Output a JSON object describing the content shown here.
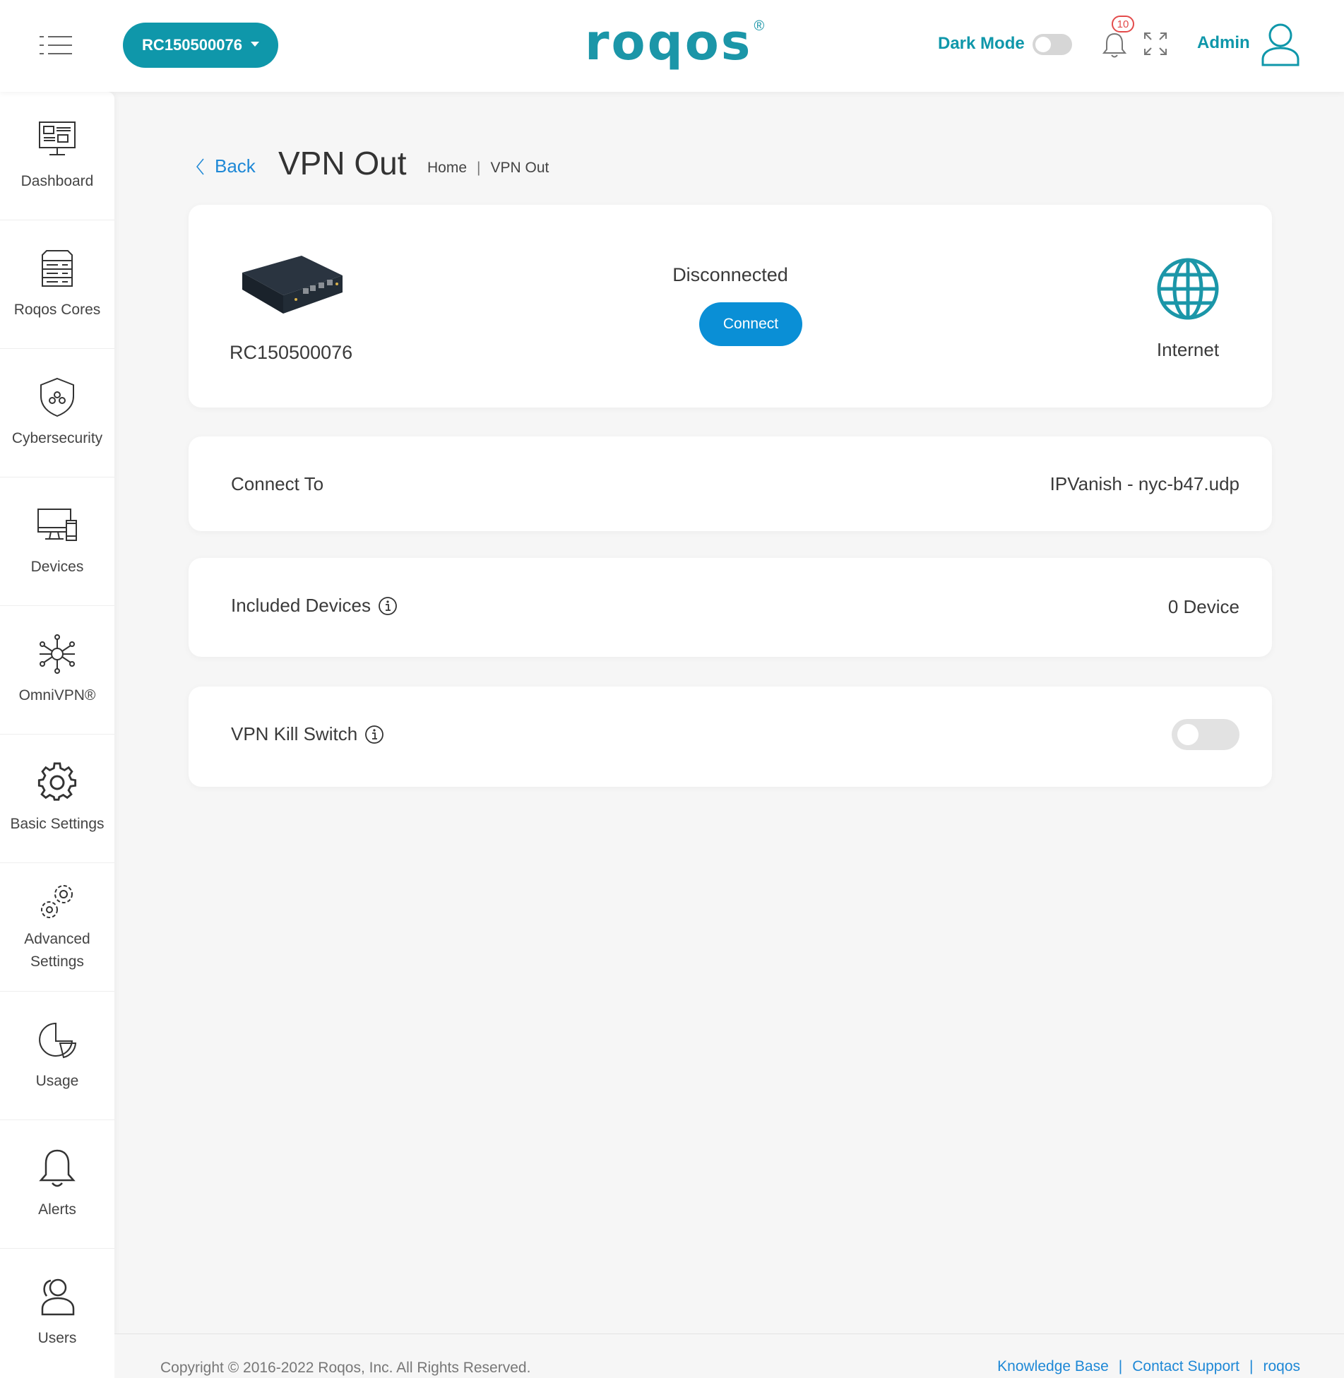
{
  "header": {
    "core_selector": "RC150500076",
    "logo_text": "roqos",
    "logo_mark": "®",
    "dark_mode_label": "Dark Mode",
    "dark_mode_on": false,
    "notification_count": "10",
    "user_label": "Admin"
  },
  "sidebar": {
    "items": [
      {
        "label": "Dashboard",
        "icon": "dashboard-icon"
      },
      {
        "label": "Roqos Cores",
        "icon": "server-icon"
      },
      {
        "label": "Cybersecurity",
        "icon": "shield-gear-icon"
      },
      {
        "label": "Devices",
        "icon": "devices-icon"
      },
      {
        "label": "OmniVPN®",
        "icon": "network-hub-icon"
      },
      {
        "label": "Basic Settings",
        "icon": "gear-icon"
      },
      {
        "label": "Advanced Settings",
        "icon": "gears-icon"
      },
      {
        "label": "Usage",
        "icon": "pie-chart-icon"
      },
      {
        "label": "Alerts",
        "icon": "bell-icon"
      },
      {
        "label": "Users",
        "icon": "users-icon"
      }
    ]
  },
  "page": {
    "back_label": "Back",
    "title": "VPN Out",
    "breadcrumb": [
      "Home",
      "VPN Out"
    ]
  },
  "status_card": {
    "device_name": "RC150500076",
    "status": "Disconnected",
    "connect_label": "Connect",
    "internet_label": "Internet"
  },
  "rows": {
    "connect_to": {
      "label": "Connect To",
      "value": "IPVanish - nyc-b47.udp"
    },
    "included_devices": {
      "label": "Included Devices",
      "value": "0 Device"
    },
    "kill_switch": {
      "label": "VPN Kill Switch",
      "enabled": false
    }
  },
  "footer": {
    "copyright": "Copyright © 2016-2022 Roqos, Inc. All Rights Reserved.",
    "links": [
      "Knowledge Base",
      "Contact Support",
      "roqos"
    ]
  },
  "colors": {
    "brand": "#0f97aa",
    "link": "#1e88d6",
    "connect_button": "#0a8fd6",
    "badge": "#e34b4b"
  }
}
